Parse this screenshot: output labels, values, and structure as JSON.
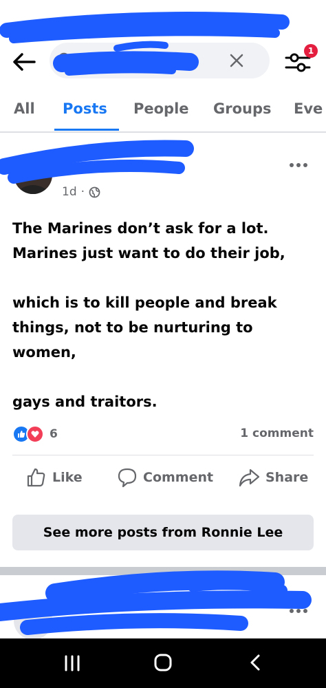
{
  "search": {
    "clear_label": "×"
  },
  "filter": {
    "badge_count": "1"
  },
  "tabs": [
    {
      "label": "All"
    },
    {
      "label": "Posts"
    },
    {
      "label": "People"
    },
    {
      "label": "Groups"
    },
    {
      "label": "Eve"
    }
  ],
  "active_tab": "Posts",
  "post": {
    "time": "1d",
    "separator": "·",
    "paragraphs": [
      "The Marines don’t ask for a lot. Marines just want to do their job,",
      "which is to kill people and break things, not to be nurturing to women,",
      "gays and traitors."
    ],
    "reaction_count": "6",
    "comment_count": "1 comment",
    "actions": {
      "like": "Like",
      "comment": "Comment",
      "share": "Share"
    },
    "see_more_label": "See more posts from Ronnie Lee"
  },
  "icons": [
    "back-arrow-icon",
    "search-icon",
    "clear-icon",
    "filter-icon",
    "globe-icon",
    "more-icon",
    "like-reaction-icon",
    "love-reaction-icon",
    "thumbs-up-icon",
    "comment-icon",
    "share-icon",
    "recents-icon",
    "home-icon",
    "nav-back-icon"
  ],
  "colors": {
    "accent": "#1877f2",
    "badge": "#e41e3f",
    "redaction": "#1f5cff",
    "muted_text": "#65676b"
  }
}
